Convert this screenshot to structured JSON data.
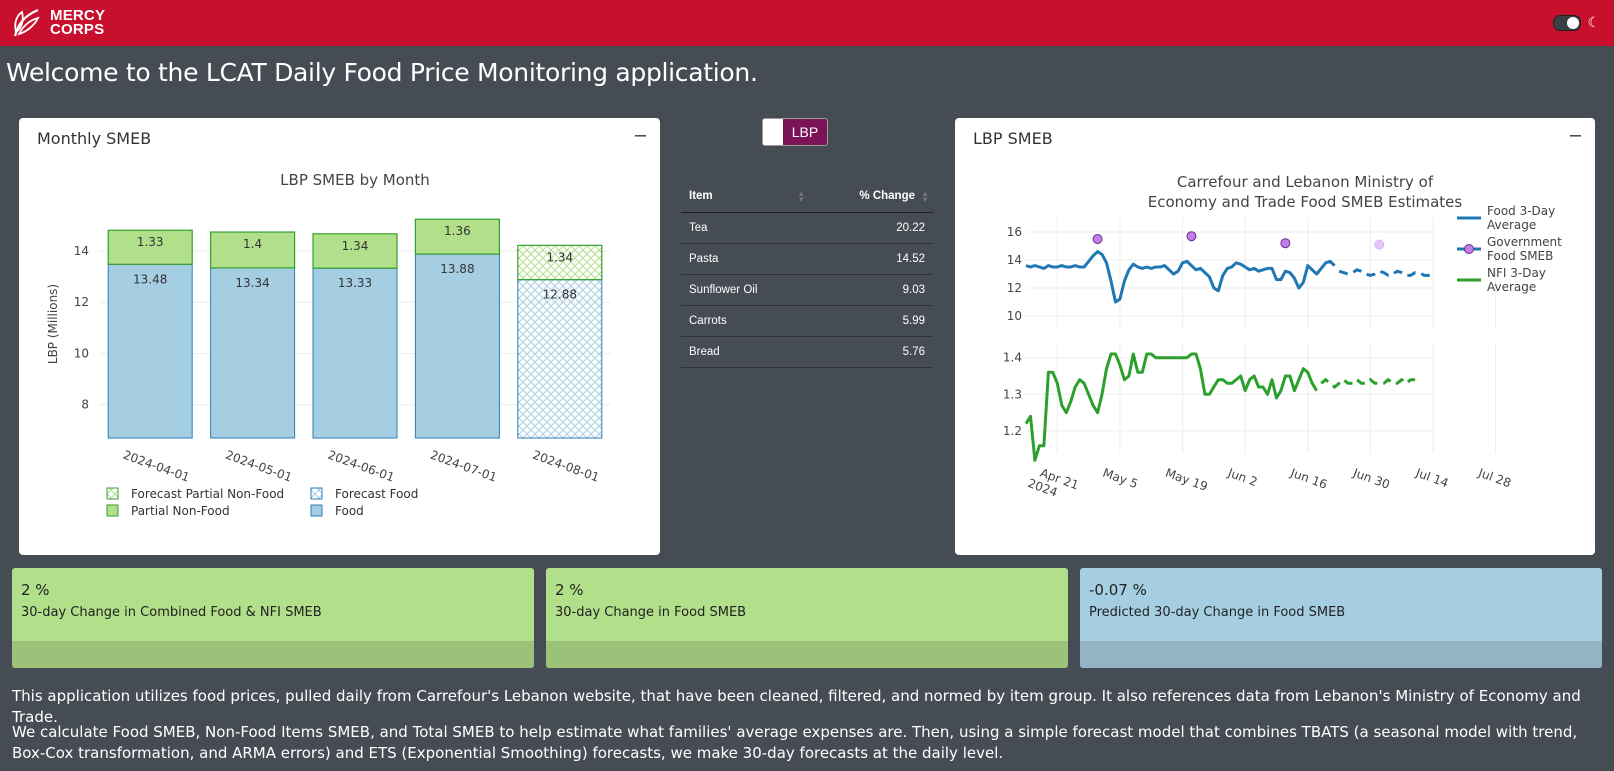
{
  "brand": {
    "name_line1": "MERCY",
    "name_line2": "CORPS",
    "color": "#c8102e"
  },
  "welcome": "Welcome to the LCAT Daily Food Price Monitoring application.",
  "monthly_card": {
    "title": "Monthly SMEB",
    "minimize": "–"
  },
  "lbp_card": {
    "title": "LBP SMEB",
    "minimize": "–"
  },
  "currency_toggle": {
    "label": "LBP"
  },
  "table": {
    "headers": [
      "Item",
      "% Change"
    ],
    "rows": [
      {
        "item": "Tea",
        "change": "20.22"
      },
      {
        "item": "Pasta",
        "change": "14.52"
      },
      {
        "item": "Sunflower Oil",
        "change": "9.03"
      },
      {
        "item": "Carrots",
        "change": "5.99"
      },
      {
        "item": "Bread",
        "change": "5.76"
      }
    ]
  },
  "stats": [
    {
      "value": "2 %",
      "label": "30-day Change in Combined Food & NFI SMEB"
    },
    {
      "value": "2 %",
      "label": "30-day Change in Food SMEB"
    },
    {
      "value": "-0.07 %",
      "label": "Predicted 30-day Change in Food SMEB"
    }
  ],
  "paragraphs": [
    "This application utilizes food prices, pulled daily from Carrefour's Lebanon website, that have been cleaned, filtered, and normed by item group. It also references data from Lebanon's Ministry of Economy and Trade.",
    "We calculate Food SMEB, Non-Food Items SMEB, and Total SMEB to help estimate what families' average expenses are. Then, using a simple forecast model that combines TBATS (a seasonal model with trend, Box-Cox transformation, and ARMA errors) and ETS (Exponential Smoothing) forecasts, we make 30-day forecasts at the daily level."
  ],
  "chart_data": [
    {
      "type": "bar",
      "title": "LBP SMEB by Month",
      "ylabel": "LBP (Millions)",
      "xlabel": "",
      "stacked": true,
      "ylim": [
        6.7,
        15.6
      ],
      "yticks": [
        "8",
        "10",
        "12",
        "14"
      ],
      "categories": [
        "2024-04-01",
        "2024-05-01",
        "2024-06-01",
        "2024-07-01",
        "2024-08-01"
      ],
      "series": [
        {
          "name": "Food",
          "values": [
            13.48,
            13.34,
            13.33,
            13.88,
            null
          ],
          "color": "#a6cee3"
        },
        {
          "name": "Partial Non-Food",
          "values": [
            1.33,
            1.4,
            1.34,
            1.36,
            null
          ],
          "color": "#b2df8a"
        },
        {
          "name": "Forecast Food",
          "values": [
            null,
            null,
            null,
            null,
            12.88
          ],
          "color": "#a6cee3",
          "pattern": "crosshatch"
        },
        {
          "name": "Forecast Partial Non-Food",
          "values": [
            null,
            null,
            null,
            null,
            1.34
          ],
          "color": "#b2df8a",
          "pattern": "crosshatch"
        }
      ],
      "data_labels": {
        "food": [
          "13.48",
          "13.34",
          "13.33",
          "13.88",
          "12.88"
        ],
        "nonfood": [
          "1.33",
          "1.4",
          "1.34",
          "1.36",
          "1.34"
        ]
      },
      "legend": [
        {
          "name": "Forecast Partial Non-Food",
          "color": "#b2df8a",
          "pattern": true
        },
        {
          "name": "Forecast Food",
          "color": "#a6cee3",
          "pattern": true
        },
        {
          "name": "Partial Non-Food",
          "color": "#b2df8a",
          "pattern": false
        },
        {
          "name": "Food",
          "color": "#a6cee3",
          "pattern": false
        }
      ],
      "legend_position": "bottom"
    },
    {
      "type": "line",
      "title_line1": "Carrefour and Lebanon Ministry of",
      "title_line2": "Economy and Trade Food SMEB Estimates",
      "x_ticks": [
        "Apr 21\n2024",
        "May 5",
        "May 19",
        "Jun 2",
        "Jun 16",
        "Jun 30",
        "Jul 14",
        "Jul 28"
      ],
      "top_panel": {
        "ylim": [
          9,
          17
        ],
        "yticks": [
          "10",
          "12",
          "14",
          "16"
        ],
        "series": [
          {
            "name": "Food 3-Day Average",
            "color": "#1f77b4",
            "values": [
              13.6,
              13.5,
              13.6,
              13.5,
              13.4,
              13.6,
              13.5,
              13.5,
              13.6,
              13.5,
              13.5,
              13.6,
              13.5,
              13.5,
              13.9,
              14.3,
              14.6,
              14.4,
              13.8,
              12.5,
              11.0,
              11.2,
              12.5,
              13.3,
              13.7,
              13.5,
              13.4,
              13.5,
              13.4,
              13.5,
              13.5,
              13.6,
              13.3,
              13.0,
              13.2,
              13.8,
              13.9,
              13.6,
              13.3,
              13.4,
              13.1,
              12.8,
              12.0,
              11.8,
              12.9,
              13.4,
              13.5,
              13.8,
              13.7,
              13.5,
              13.3,
              13.4,
              13.2,
              13.3,
              13.4,
              13.4,
              12.6,
              12.6,
              13.2,
              13.1,
              12.7,
              12.0,
              12.4,
              13.6,
              13.3,
              13.0,
              13.4,
              13.8,
              13.9,
              13.6
            ]
          },
          {
            "name": "Food 3-Day Average forecast",
            "color": "#1f77b4",
            "dashed": true,
            "values": [
              13.2,
              13.1,
              13.0,
              13.1,
              13.3,
              13.2,
              13.0,
              12.9,
              13.0,
              13.2,
              13.1,
              12.9,
              13.0,
              13.2,
              13.1,
              12.9,
              12.9,
              13.1,
              13.1,
              12.9,
              12.9,
              12.9
            ]
          },
          {
            "name": "Government Food SMEB",
            "color": "#c080e8",
            "points": [
              [
                16,
                15.5
              ],
              [
                37,
                15.7
              ],
              [
                58,
                15.2
              ],
              [
                79,
                15.1
              ]
            ]
          }
        ]
      },
      "bottom_panel": {
        "ylim": [
          1.14,
          1.44
        ],
        "yticks": [
          "1.2",
          "1.3",
          "1.4"
        ],
        "series": [
          {
            "name": "NFI 3-Day Average",
            "color": "#2ca02c",
            "values": [
              1.22,
              1.24,
              1.12,
              1.16,
              1.16,
              1.36,
              1.36,
              1.33,
              1.27,
              1.25,
              1.28,
              1.32,
              1.34,
              1.33,
              1.3,
              1.27,
              1.25,
              1.3,
              1.37,
              1.41,
              1.41,
              1.38,
              1.34,
              1.35,
              1.41,
              1.36,
              1.36,
              1.41,
              1.41,
              1.4,
              1.4,
              1.4,
              1.4,
              1.4,
              1.4,
              1.4,
              1.4,
              1.41,
              1.41,
              1.37,
              1.3,
              1.3,
              1.32,
              1.34,
              1.34,
              1.33,
              1.33,
              1.34,
              1.35,
              1.31,
              1.34,
              1.35,
              1.32,
              1.32,
              1.3,
              1.34,
              1.29,
              1.31,
              1.35,
              1.35,
              1.31,
              1.34,
              1.37,
              1.36,
              1.33,
              1.31
            ]
          },
          {
            "name": "NFI forecast",
            "color": "#2ca02c",
            "dashed": true,
            "values": [
              1.33,
              1.34,
              1.33,
              1.32,
              1.33,
              1.34,
              1.33,
              1.33,
              1.34,
              1.33,
              1.33,
              1.34,
              1.33,
              1.33,
              1.33,
              1.34,
              1.33,
              1.33,
              1.34,
              1.33,
              1.34,
              1.34
            ]
          }
        ]
      },
      "legend": [
        {
          "name_line1": "Food 3-Day",
          "name_line2": "Average",
          "color": "#1f77b4",
          "marker": false
        },
        {
          "name_line1": "Government",
          "name_line2": "Food SMEB",
          "color": "#1f77b4",
          "marker": true,
          "marker_color": "#c080e8"
        },
        {
          "name_line1": "NFI 3-Day",
          "name_line2": "Average",
          "color": "#2ca02c",
          "marker": false
        }
      ],
      "legend_position": "right"
    }
  ]
}
